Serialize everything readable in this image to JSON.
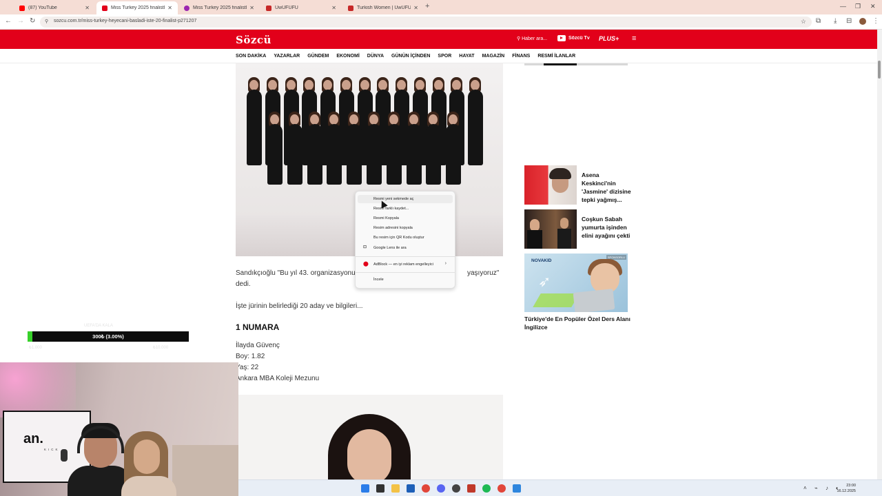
{
  "browser": {
    "tabs": [
      {
        "label": "(87) YouTube",
        "color": "#ff0000"
      },
      {
        "label": "Miss Turkey 2025 finalistleri be",
        "color": "#e2001a"
      },
      {
        "label": "Miss Turkey 2025 finalistleri kim",
        "color": "#9c27b0"
      },
      {
        "label": "UwUFUFU",
        "color": "#c62828"
      },
      {
        "label": "Turkish Women | UwUFUFU",
        "color": "#c62828"
      }
    ],
    "new_tab": "+",
    "url": "sozcu.com.tr/miss-turkey-heyecani-basladi-iste-20-finalist-p271207"
  },
  "site": {
    "logo": "Sözcü",
    "search_label": "Haber ara...",
    "tv_label": "Sözcü Tv",
    "plus_label": "PLUS+",
    "nav": [
      "SON DAKİKA",
      "YAZARLAR",
      "GÜNDEM",
      "EKONOMİ",
      "DÜNYA",
      "GÜNÜN İÇİNDEN",
      "SPOR",
      "HAYAT",
      "MAGAZİN",
      "FİNANS",
      "RESMİ İLANLAR"
    ]
  },
  "article": {
    "para1_line1": "Sandıkçıoğlu \"Bu yıl 43. organizasyonun",
    "para1_line1_end": "yaşıyoruz\"",
    "para1_line2": "dedi.",
    "para2": "İşte jürinin belirlediği 20 aday ve bilgileri...",
    "heading": "1 NUMARA",
    "details": [
      "İlayda Güvenç",
      "Boy: 1.82",
      "Yaş: 22",
      "Ankara MBA Koleji Mezunu"
    ]
  },
  "sidebar": {
    "news": [
      {
        "title": "Asena Keskinci'nin 'Jasmine' dizisine tepki yağmış..."
      },
      {
        "title": "Coşkun Sabah yumurta işinden elini ayağını çekti"
      }
    ],
    "sponsor_brand": "NOVAKID",
    "sponsor_tag": "SPONSORLU",
    "sponsor_title": "Türkiye'de En Popüler Özel Ders Alanı İngilizce"
  },
  "context_menu": {
    "items": [
      "Resmi yeni sekmede aç",
      "Resmi farklı kaydet...",
      "Resmi Kopyala",
      "Resim adresini kopyala",
      "Bu resim için QR Kodu oluştur",
      "Google Lens ile ara"
    ],
    "extension": "AdBlock — en iyi reklam engelleyici",
    "inspect": "İncele"
  },
  "overlay": {
    "progress_label": "300₺ (3.00%)",
    "progress_fraction": 0.03,
    "ghost_top": "UEFA'DA KALA",
    "ghost_left": "₺1.000",
    "ghost_right": "₺10.000"
  },
  "webcam": {
    "logo": "an.",
    "logo_sub": "KICK"
  },
  "taskbar": {
    "time": "23:00",
    "date": "16.12.2025"
  },
  "colors": {
    "brand": "#e2001a",
    "progress": "#37d12a"
  }
}
